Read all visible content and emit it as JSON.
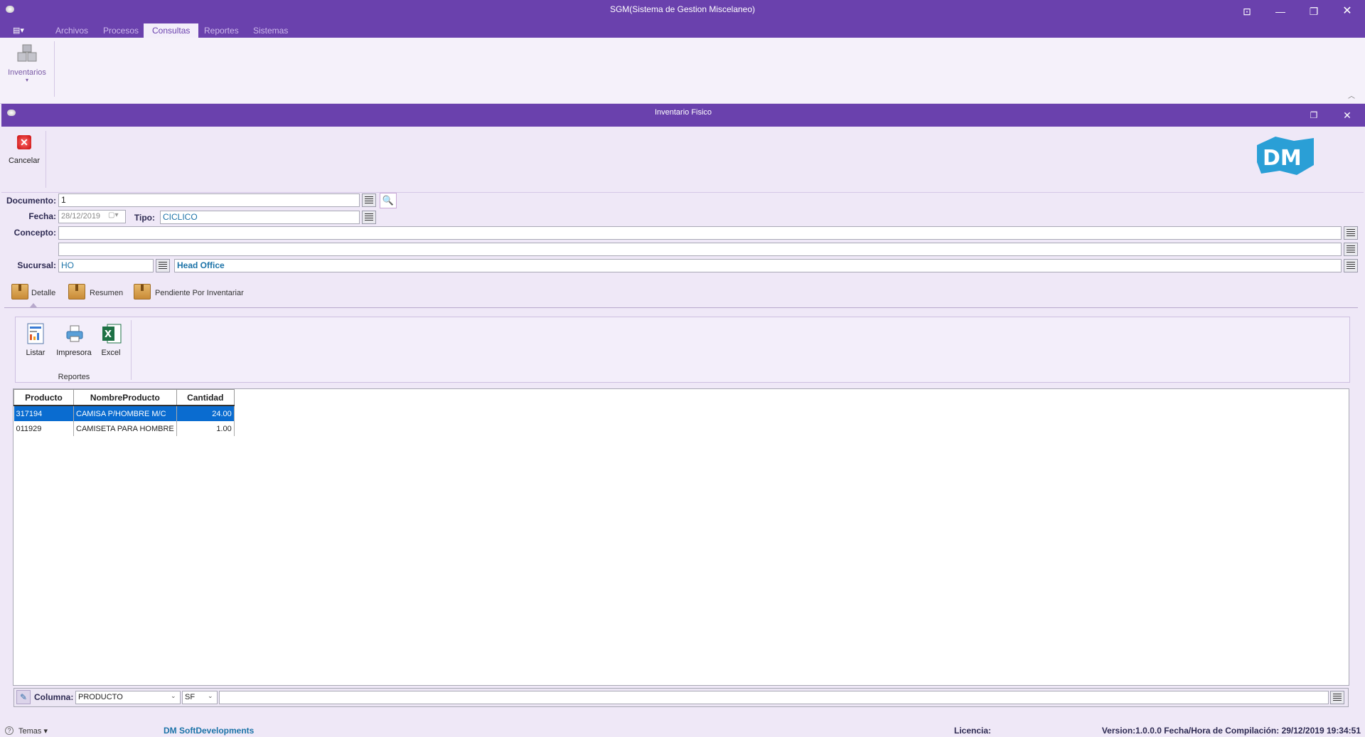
{
  "app": {
    "title": "SGM(Sistema de Gestion Miscelaneo)",
    "menu_tabs": [
      "Archivos",
      "Procesos",
      "Consultas",
      "Reportes",
      "Sistemas"
    ],
    "active_tab": "Consultas",
    "ribbon_item": "Inventarios"
  },
  "child": {
    "title": "Inventario Fisico",
    "cancel_label": "Cancelar"
  },
  "form": {
    "documento_label": "Documento:",
    "documento_value": "1",
    "fecha_label": "Fecha:",
    "fecha_value": "28/12/2019",
    "tipo_label": "Tipo:",
    "tipo_value": "CICLICO",
    "concepto_label": "Concepto:",
    "concepto_value": "",
    "concepto2_value": "",
    "sucursal_label": "Sucursal:",
    "sucursal_code": "HO",
    "sucursal_name": "Head Office"
  },
  "subtabs": [
    "Detalle",
    "Resumen",
    "Pendiente Por Inventariar"
  ],
  "reports": {
    "listar": "Listar",
    "impresora": "Impresora",
    "excel": "Excel",
    "group_label": "Reportes"
  },
  "grid": {
    "columns": [
      "Producto",
      "NombreProducto",
      "Cantidad"
    ],
    "rows": [
      [
        "317194",
        "CAMISA P/HOMBRE M/C",
        "24.00"
      ],
      [
        "011929",
        "CAMISETA PARA HOMBRE",
        "1.00"
      ]
    ]
  },
  "filter": {
    "label": "Columna:",
    "column_value": "PRODUCTO",
    "operator_value": "SF",
    "search_value": ""
  },
  "status": {
    "temas": "Temas",
    "company": "DM SoftDevelopments",
    "licencia": "Licencia:",
    "version": "Version:1.0.0.0 Fecha/Hora de Compilación: 29/12/2019 19:34:51"
  },
  "colors": {
    "accent": "#6a41ad",
    "selection": "#0a6cd0",
    "logo": "#2a9fd6"
  }
}
